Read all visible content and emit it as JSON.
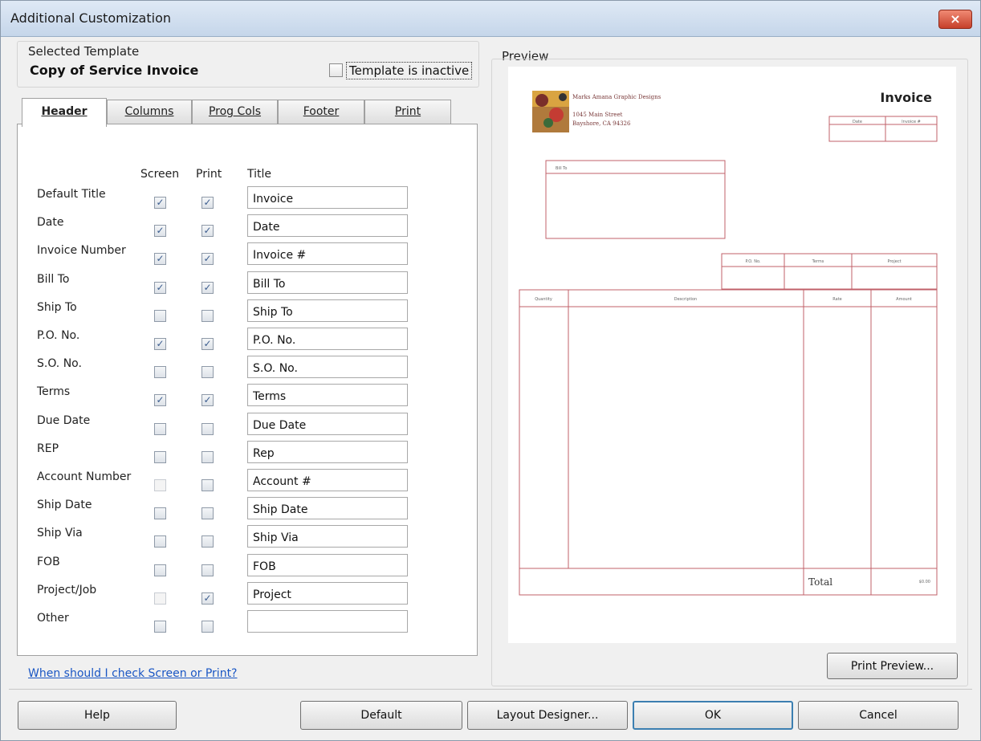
{
  "window": {
    "title": "Additional Customization",
    "close_glyph": "×"
  },
  "template": {
    "caption": "Selected Template",
    "name": "Copy of Service Invoice",
    "inactive_label": "Template is inactive",
    "inactive_checked": false
  },
  "tabs": [
    {
      "label": "Header",
      "active": true
    },
    {
      "label": "Columns",
      "active": false
    },
    {
      "label": "Prog Cols",
      "active": false
    },
    {
      "label": "Footer",
      "active": false
    },
    {
      "label": "Print",
      "active": false
    }
  ],
  "header_table": {
    "col_screen": "Screen",
    "col_print": "Print",
    "col_title": "Title",
    "rows": [
      {
        "label": "Default Title",
        "screen": true,
        "print": true,
        "title": "Invoice"
      },
      {
        "label": "Date",
        "screen": true,
        "print": true,
        "title": "Date"
      },
      {
        "label": "Invoice Number",
        "screen": true,
        "print": true,
        "title": "Invoice #"
      },
      {
        "label": "Bill To",
        "screen": true,
        "print": true,
        "title": "Bill To"
      },
      {
        "label": "Ship To",
        "screen": false,
        "print": false,
        "title": "Ship To"
      },
      {
        "label": "P.O. No.",
        "screen": true,
        "print": true,
        "title": "P.O. No."
      },
      {
        "label": "S.O. No.",
        "screen": false,
        "print": false,
        "title": "S.O. No."
      },
      {
        "label": "Terms",
        "screen": true,
        "print": true,
        "title": "Terms"
      },
      {
        "label": "Due Date",
        "screen": false,
        "print": false,
        "title": "Due Date"
      },
      {
        "label": "REP",
        "screen": false,
        "print": false,
        "title": "Rep"
      },
      {
        "label": "Account Number",
        "screen": false,
        "print": false,
        "title": "Account #",
        "screen_disabled": true
      },
      {
        "label": "Ship Date",
        "screen": false,
        "print": false,
        "title": "Ship Date"
      },
      {
        "label": "Ship Via",
        "screen": false,
        "print": false,
        "title": "Ship Via"
      },
      {
        "label": "FOB",
        "screen": false,
        "print": false,
        "title": "FOB"
      },
      {
        "label": "Project/Job",
        "screen": false,
        "print": true,
        "title": "Project",
        "screen_disabled": true
      },
      {
        "label": "Other",
        "screen": false,
        "print": false,
        "title": ""
      }
    ]
  },
  "help_link": "When should I check Screen or Print?",
  "preview": {
    "caption": "Preview",
    "company_name": "Marks Amana Graphic Designs",
    "company_address1": "1045 Main Street",
    "company_address2": "Bayshore, CA 94326",
    "doc_title": "Invoice",
    "date_label": "Date",
    "invoice_no_label": "Invoice #",
    "bill_to_label": "Bill To",
    "po_label": "P.O. No.",
    "terms_label": "Terms",
    "project_label": "Project",
    "col_quantity": "Quantity",
    "col_description": "Description",
    "col_rate": "Rate",
    "col_amount": "Amount",
    "total_label": "Total",
    "total_value": "$0.00",
    "line_color": "#c0606a"
  },
  "buttons": {
    "print_preview": "Print Preview...",
    "help": "Help",
    "default": "Default",
    "layout_designer": "Layout Designer...",
    "ok": "OK",
    "cancel": "Cancel"
  }
}
